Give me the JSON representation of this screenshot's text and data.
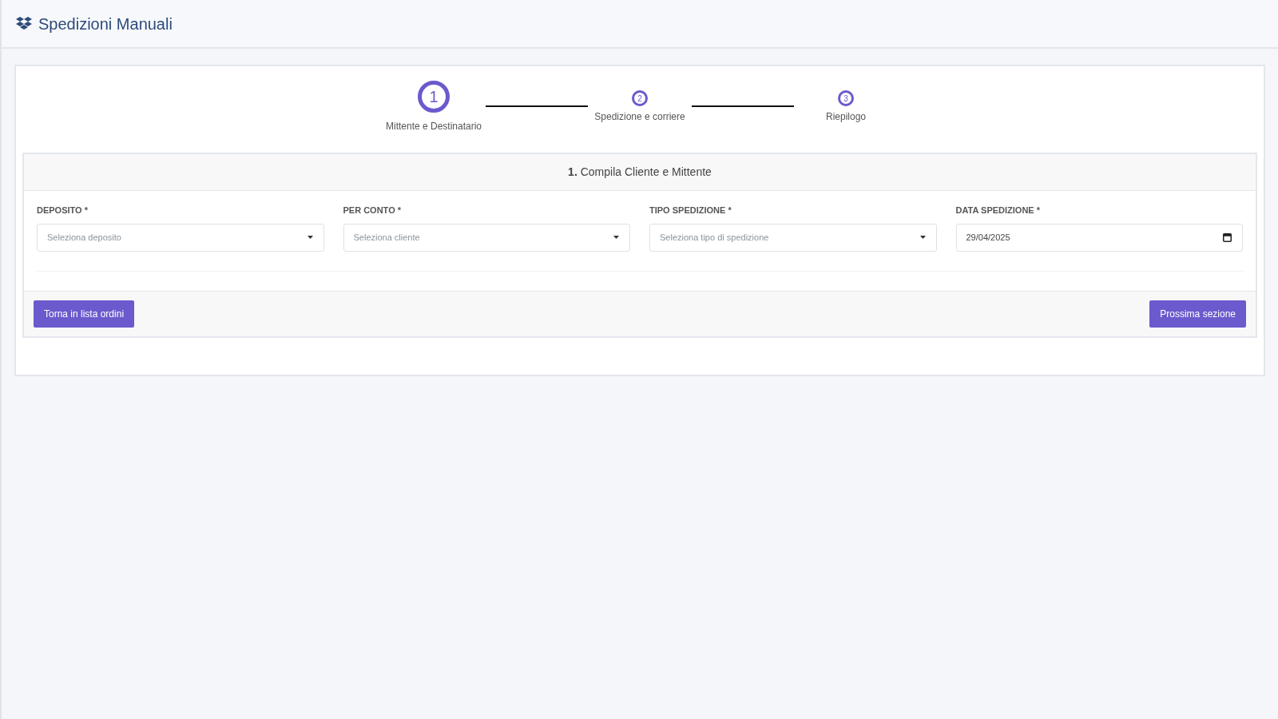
{
  "app_title": "Spedizioni Manuali",
  "steps": [
    {
      "number": "1",
      "label": "Mittente e Destinatario",
      "selected": true
    },
    {
      "number": "2",
      "label": "Spedizione e corriere",
      "selected": false
    },
    {
      "number": "3",
      "label": "Riepilogo",
      "selected": false
    }
  ],
  "section_title": "**1.** Compila Cliente e Mittente",
  "fields": [
    {
      "kind": "select",
      "label": "DEPOSITO *",
      "placeholder": "Seleziona deposito"
    },
    {
      "kind": "select",
      "label": "PER CONTO *",
      "placeholder": "Seleziona cliente"
    },
    {
      "kind": "select",
      "label": "TIPO SPEDIZIONE *",
      "placeholder": "Seleziona tipo di spedizione"
    },
    {
      "kind": "date",
      "label": "DATA SPEDIZIONE *",
      "value": "29/04/2025"
    }
  ],
  "buttons": {
    "back": "Torna in lista ordini",
    "next": "Prossima sezione"
  }
}
